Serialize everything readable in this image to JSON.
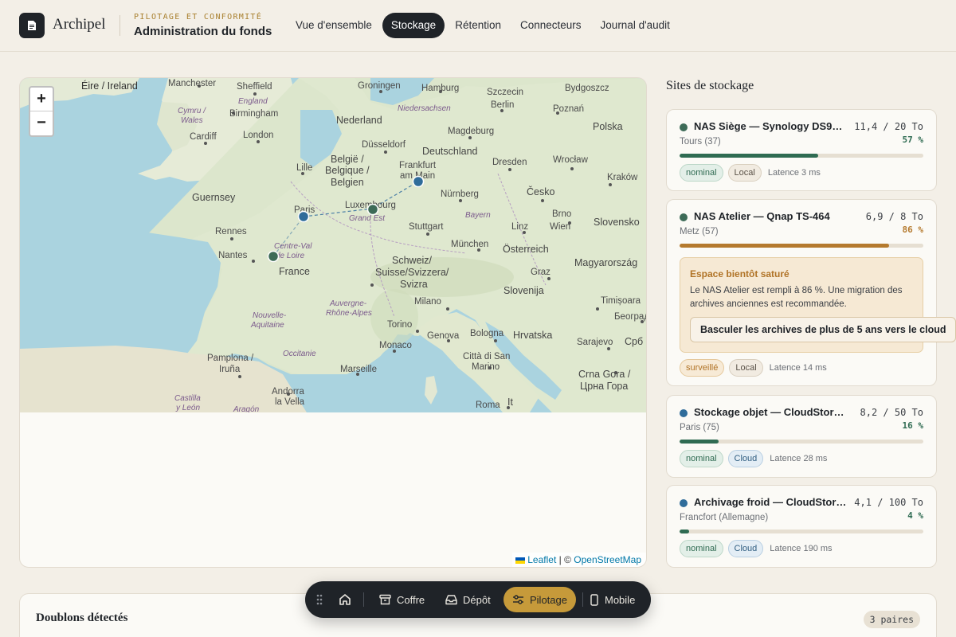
{
  "header": {
    "brand": "Archipel",
    "eyebrow": "PILOTAGE ET CONFORMITÉ",
    "title": "Administration du fonds",
    "nav": [
      "Vue d'ensemble",
      "Stockage",
      "Rétention",
      "Connecteurs",
      "Journal d'audit"
    ],
    "active_nav": "Stockage"
  },
  "map": {
    "zoom_in": "+",
    "zoom_out": "−",
    "attribution_sep": "|",
    "attribution_leaflet": "Leaflet",
    "attribution_copy": "©",
    "attribution_osm": "OpenStreetMap",
    "labels": {
      "eire": "Éire / Ireland",
      "manchester": "Manchester",
      "sheffield": "Sheffield",
      "england": "England",
      "cymru": "Cymru /",
      "wales": "Wales",
      "birmingham": "Birmingham",
      "london": "London",
      "cardiff": "Cardiff",
      "guernsey": "Guernsey",
      "groningen": "Groningen",
      "hamburg": "Hamburg",
      "szczecin": "Szczecin",
      "bydgoszcz": "Bydgoszcz",
      "niedersachsen": "Niedersachsen",
      "berlin": "Berlin",
      "poznan": "Poznań",
      "nederland": "Nederland",
      "magdeburg": "Magdeburg",
      "polska": "Polska",
      "dusseldorf": "Düsseldorf",
      "deutschland": "Deutschland",
      "lille": "Lille",
      "belgie1": "België /",
      "belgie2": "Belgique /",
      "belgie3": "Belgien",
      "frankfurt1": "Frankfurt",
      "frankfurt2": "am Main",
      "dresden": "Dresden",
      "wroclaw": "Wrocław",
      "krakow": "Kraków",
      "paris": "Paris",
      "luxembourg": "Luxembourg",
      "grandest": "Grand Est",
      "nurnberg": "Nürnberg",
      "cesko": "Česko",
      "bayern": "Bayern",
      "brno": "Brno",
      "slovensko": "Slovensko",
      "stuttgart": "Stuttgart",
      "linz": "Linz",
      "wien": "Wien",
      "rennes": "Rennes",
      "nantes": "Nantes",
      "centre1": "Centre-Val",
      "centre2": "de Loire",
      "munchen": "München",
      "osterreich": "Österreich",
      "magyar": "Magyarország",
      "france": "France",
      "schweiz1": "Schweiz/",
      "schweiz2": "Suisse/Svizzera/",
      "schweiz3": "Svizra",
      "graz": "Graz",
      "slovenija": "Slovenija",
      "auvergne1": "Auvergne-",
      "auvergne2": "Rhône-Alpes",
      "milano": "Milano",
      "timisoara": "Timișoara",
      "nouvelle1": "Nouvelle-",
      "nouvelle2": "Aquitaine",
      "beograd": "Београд",
      "torino": "Torino",
      "genova": "Genova",
      "bologna": "Bologna",
      "hrvatska": "Hrvatska",
      "monaco": "Monaco",
      "sarajevo": "Sarajevo",
      "srbija": "Срб",
      "pamplona1": "Pamplona /",
      "pamplona2": "Iruña",
      "occitanie": "Occitanie",
      "marseille": "Marseille",
      "sanmarino1": "Città di San",
      "sanmarino2": "Marino",
      "montenegro1": "Crna Gora /",
      "montenegro2": "Црна Гора",
      "castilla1": "Castilla",
      "castilla2": "y León",
      "andorra1": "Andorra",
      "andorra2": "la Vella",
      "aragon": "Aragón",
      "roma": "Roma",
      "it": "It"
    }
  },
  "sites": {
    "title": "Sites de stockage",
    "items": [
      {
        "name": "NAS Siège — Synology DS9…",
        "capacity": "11,4 / 20 To",
        "location": "Tours (37)",
        "percent": "57 %",
        "fill": 0.57,
        "status": "nominal",
        "kind": "Local",
        "latency": "Latence 3 ms",
        "color": "#3d6b57"
      },
      {
        "name": "NAS Atelier — Qnap TS-464",
        "capacity": "6,9 / 8 To",
        "location": "Metz (57)",
        "percent": "86 %",
        "fill": 0.86,
        "status": "surveillé",
        "kind": "Local",
        "latency": "Latence 14 ms",
        "color": "#b57a2e"
      },
      {
        "name": "Stockage objet — CloudStore …",
        "capacity": "8,2 / 50 To",
        "location": "Paris (75)",
        "percent": "16 %",
        "fill": 0.16,
        "status": "nominal",
        "kind": "Cloud",
        "latency": "Latence 28 ms",
        "color": "#2f6c9a"
      },
      {
        "name": "Archivage froid — CloudStor…",
        "capacity": "4,1 / 100 To",
        "location": "Francfort (Allemagne)",
        "percent": "4 %",
        "fill": 0.04,
        "status": "nominal",
        "kind": "Cloud",
        "latency": "Latence 190 ms",
        "color": "#2f6c9a"
      }
    ],
    "alert": {
      "title": "Espace bientôt saturé",
      "text": "Le NAS Atelier est rempli à 86 %. Une migration des archives anciennes est recommandée.",
      "button": "Basculer les archives de plus de 5 ans vers le cloud"
    }
  },
  "duplicates": {
    "title": "Doublons détectés",
    "count": "3 paires"
  },
  "dock": {
    "items": [
      "Coffre",
      "Dépôt",
      "Pilotage",
      "Mobile"
    ],
    "active": "Pilotage"
  },
  "colors": {
    "ink": "#1f2328",
    "accent": "#c69a3a",
    "ok": "#2f6b52",
    "warn": "#b57a2e",
    "cloud": "#2f6c9a"
  }
}
